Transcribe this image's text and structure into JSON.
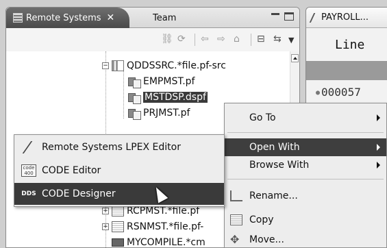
{
  "left_view": {
    "tabs": [
      {
        "label": "Remote Systems",
        "close": "✕",
        "active": true
      },
      {
        "label": "Team",
        "active": false
      }
    ],
    "toolbar_icons": [
      "link-icon",
      "refresh-icon",
      "back-icon",
      "forward-icon",
      "home-icon",
      "collapse-icon",
      "sync-icon",
      "view-menu-icon"
    ]
  },
  "tree": {
    "rows": [
      {
        "label": "QDDSSRC.*file.pf-src",
        "icon": "source-file-icon",
        "expander": "−"
      },
      {
        "label": "EMPMST.pf",
        "icon": "member-icon"
      },
      {
        "label": "MSTDSP.dspf",
        "icon": "member-icon",
        "selected": true
      },
      {
        "label": "PRJMST.pf",
        "icon": "member-icon"
      },
      {
        "label": "RCPMST.*file.pf",
        "icon": "file-icon",
        "expander": "+"
      },
      {
        "label": "RSNMST.*file.pf-",
        "icon": "file-icon",
        "expander": "+"
      },
      {
        "label": "MYCOMPILE.*cm",
        "icon": "command-icon"
      }
    ]
  },
  "editor": {
    "tab_label": "PAYROLL...",
    "ruler": "Line",
    "line_number": "000057"
  },
  "context_menu": {
    "items": [
      {
        "label": "Go To",
        "submenu": true
      },
      {
        "label": "Open With",
        "submenu": true,
        "active": true
      },
      {
        "label": "Browse With",
        "submenu": true
      },
      {
        "label": "Rename...",
        "icon": "rename-icon"
      },
      {
        "label": "Copy",
        "icon": "copy-icon"
      },
      {
        "label": "Move...",
        "icon": "move-icon"
      }
    ]
  },
  "submenu": {
    "items": [
      {
        "label": "Remote Systems LPEX Editor",
        "icon": "lpex-editor-icon"
      },
      {
        "label": "CODE Editor",
        "icon": "code-editor-icon",
        "icon_text": "code 400"
      },
      {
        "label": "CODE Designer",
        "icon": "code-designer-icon",
        "icon_text": "DDS",
        "active": true
      }
    ]
  }
}
